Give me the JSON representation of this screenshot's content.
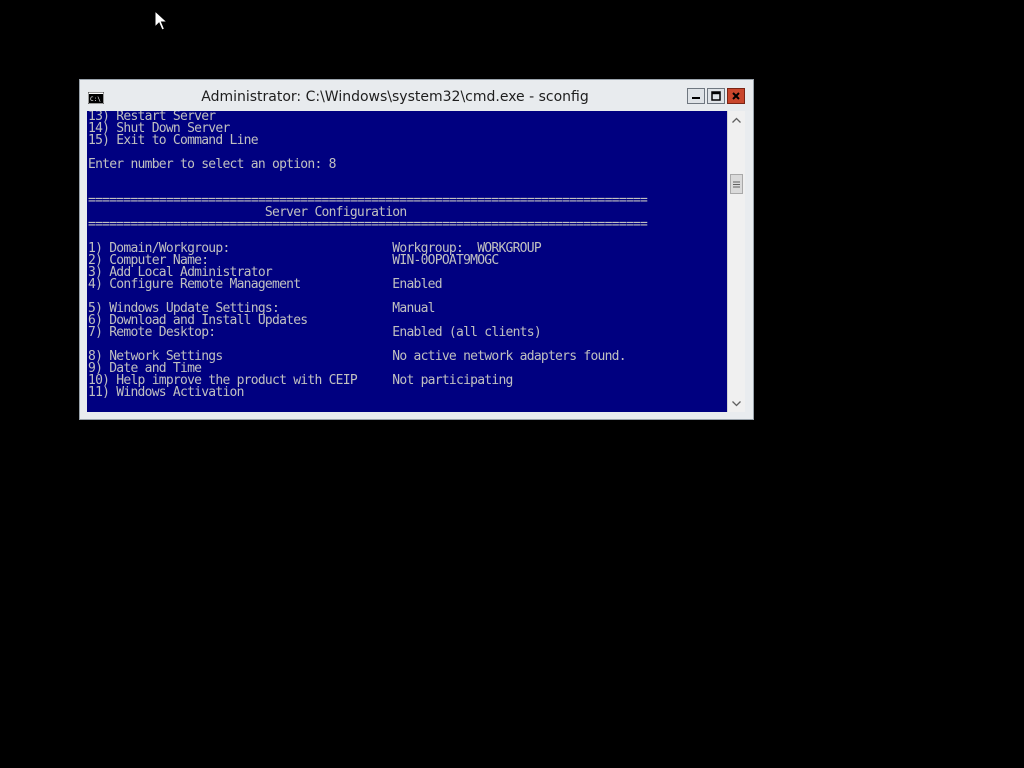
{
  "window": {
    "title": "Administrator: C:\\Windows\\system32\\cmd.exe - sconfig",
    "controls": {
      "minimize_icon": "minimize-icon",
      "maximize_icon": "maximize-icon",
      "close_icon": "close-icon",
      "close_color": "#c9462c"
    }
  },
  "console": {
    "background_color": "#000080",
    "text_color": "#c0c0c0",
    "lines": [
      "13) Restart Server",
      "14) Shut Down Server",
      "15) Exit to Command Line",
      "",
      "Enter number to select an option: 8",
      "",
      "",
      "===============================================================================",
      "                         Server Configuration",
      "===============================================================================",
      "",
      "1) Domain/Workgroup:                       Workgroup:  WORKGROUP",
      "2) Computer Name:                          WIN-0OPOAT9MOGC",
      "3) Add Local Administrator",
      "4) Configure Remote Management             Enabled",
      "",
      "5) Windows Update Settings:                Manual",
      "6) Download and Install Updates",
      "7) Remote Desktop:                         Enabled (all clients)",
      "",
      "8) Network Settings                        No active network adapters found.",
      "9) Date and Time",
      "10) Help improve the product with CEIP     Not participating",
      "11) Windows Activation"
    ]
  },
  "scrollbar": {
    "up_icon": "chevron-up-icon",
    "down_icon": "chevron-down-icon",
    "thumb_grip_icon": "grip-lines-icon",
    "position": 0.22
  },
  "icons": {
    "cursor": "mouse-pointer-icon",
    "app": "cmd-icon"
  }
}
